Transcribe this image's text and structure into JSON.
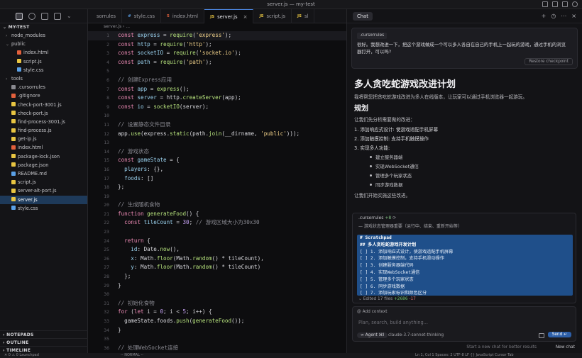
{
  "window": {
    "title": "server.js — my-test"
  },
  "explorer": {
    "root": "MY-TEST",
    "items": [
      {
        "label": "node_modules",
        "kind": "folder",
        "depth": 1,
        "chevron": "›"
      },
      {
        "label": "public",
        "kind": "folder",
        "depth": 1,
        "chevron": "⌄"
      },
      {
        "label": "index.html",
        "kind": "html",
        "depth": 2
      },
      {
        "label": "script.js",
        "kind": "js",
        "depth": 2
      },
      {
        "label": "style.css",
        "kind": "css",
        "depth": 2
      },
      {
        "label": "tools",
        "kind": "folder",
        "depth": 1,
        "chevron": "›"
      },
      {
        "label": ".cursorrules",
        "kind": "rules",
        "depth": 1
      },
      {
        "label": ".gitignore",
        "kind": "git",
        "depth": 1
      },
      {
        "label": "check-port-3001.js",
        "kind": "js",
        "depth": 1
      },
      {
        "label": "check-port.js",
        "kind": "js",
        "depth": 1
      },
      {
        "label": "find-process-3001.js",
        "kind": "js",
        "depth": 1
      },
      {
        "label": "find-process.js",
        "kind": "js",
        "depth": 1
      },
      {
        "label": "get-ip.js",
        "kind": "js",
        "depth": 1
      },
      {
        "label": "index.html",
        "kind": "html",
        "depth": 1
      },
      {
        "label": "package-lock.json",
        "kind": "json",
        "depth": 1
      },
      {
        "label": "package.json",
        "kind": "json",
        "depth": 1
      },
      {
        "label": "README.md",
        "kind": "md",
        "depth": 1
      },
      {
        "label": "script.js",
        "kind": "js",
        "depth": 1
      },
      {
        "label": "server-alt-port.js",
        "kind": "js",
        "depth": 1
      },
      {
        "label": "server.js",
        "kind": "js",
        "depth": 1,
        "selected": true
      },
      {
        "label": "style.css",
        "kind": "css",
        "depth": 1
      }
    ],
    "bottom_sections": [
      "NOTEPADS",
      "OUTLINE",
      "TIMELINE"
    ]
  },
  "colors": {
    "js": "#e8c542",
    "html": "#e2603c",
    "css": "#5aa0e6",
    "json": "#e8c542",
    "md": "#5aa0e6",
    "folder": "#8a8a90",
    "rules": "#8a8a90",
    "git": "#e2603c",
    "accent": "#4d8ae8"
  },
  "editor": {
    "tabs": [
      {
        "label": "sorrules",
        "glyph": "",
        "active": false
      },
      {
        "label": "style.css",
        "glyph": "#",
        "active": false
      },
      {
        "label": "index.html",
        "glyph": "5",
        "active": false
      },
      {
        "label": "server.js",
        "glyph": "JS",
        "active": true
      },
      {
        "label": "script.js",
        "glyph": "JS",
        "active": false
      },
      {
        "label": "sl",
        "glyph": "JS",
        "active": false
      }
    ],
    "breadcrumb": "server.js › ...",
    "lines": [
      {
        "n": "1",
        "html": "<span class='kw'>const</span> <span class='var'>express</span> = <span class='fn'>require</span>(<span class='str'>'express'</span>);",
        "cursor": true
      },
      {
        "n": "2",
        "html": "<span class='kw'>const</span> <span class='var'>http</span> = <span class='fn'>require</span>(<span class='str'>'http'</span>);"
      },
      {
        "n": "3",
        "html": "<span class='kw'>const</span> <span class='var'>socketIO</span> = <span class='fn'>require</span>(<span class='str'>'socket.io'</span>);"
      },
      {
        "n": "4",
        "html": "<span class='kw'>const</span> <span class='var'>path</span> = <span class='fn'>require</span>(<span class='str'>'path'</span>);"
      },
      {
        "n": "5",
        "html": ""
      },
      {
        "n": "6",
        "html": "<span class='cm'>// 创建Express应用</span>"
      },
      {
        "n": "7",
        "html": "<span class='kw'>const</span> <span class='var'>app</span> = <span class='fn'>express</span>();"
      },
      {
        "n": "8",
        "html": "<span class='kw'>const</span> <span class='var'>server</span> = http.<span class='fn'>createServer</span>(app);"
      },
      {
        "n": "9",
        "html": "<span class='kw'>const</span> <span class='var'>io</span> = <span class='fn'>socketIO</span>(server);"
      },
      {
        "n": "10",
        "html": ""
      },
      {
        "n": "11",
        "html": "<span class='cm'>// 设置静态文件目录</span>"
      },
      {
        "n": "12",
        "html": "app.<span class='fn'>use</span>(express.<span class='fn'>static</span>(path.<span class='fn'>join</span>(__dirname, <span class='str'>'public'</span>)));"
      },
      {
        "n": "13",
        "html": ""
      },
      {
        "n": "14",
        "html": "<span class='cm'>// 游戏状态</span>"
      },
      {
        "n": "15",
        "html": "<span class='kw'>const</span> <span class='var'>gameState</span> = {"
      },
      {
        "n": "16",
        "html": "  <span class='prop'>players</span>: {},"
      },
      {
        "n": "17",
        "html": "  <span class='prop'>foods</span>: []"
      },
      {
        "n": "18",
        "html": "};"
      },
      {
        "n": "19",
        "html": ""
      },
      {
        "n": "20",
        "html": "<span class='cm'>// 生成随机食物</span>"
      },
      {
        "n": "21",
        "html": "<span class='kw'>function</span> <span class='fn'>generateFood</span>() {"
      },
      {
        "n": "22",
        "html": "  <span class='kw'>const</span> <span class='var'>tileCount</span> = <span class='num'>30</span>; <span class='cm'>// 游戏区域大小为30x30</span>"
      },
      {
        "n": "23",
        "html": ""
      },
      {
        "n": "24",
        "html": "  <span class='kw'>return</span> {"
      },
      {
        "n": "25",
        "html": "    <span class='prop'>id</span>: Date.<span class='fn'>now</span>(),"
      },
      {
        "n": "26",
        "html": "    <span class='prop'>x</span>: Math.<span class='fn'>floor</span>(Math.<span class='fn'>random</span>() * tileCount),"
      },
      {
        "n": "27",
        "html": "    <span class='prop'>y</span>: Math.<span class='fn'>floor</span>(Math.<span class='fn'>random</span>() * tileCount)"
      },
      {
        "n": "28",
        "html": "  };"
      },
      {
        "n": "29",
        "html": "}"
      },
      {
        "n": "30",
        "html": ""
      },
      {
        "n": "31",
        "html": "<span class='cm'>// 初始化食物</span>"
      },
      {
        "n": "32",
        "html": "<span class='kw'>for</span> (<span class='kw'>let</span> i = <span class='num'>0</span>; i &lt; <span class='num'>5</span>; i++) {"
      },
      {
        "n": "33",
        "html": "  gameState.foods.<span class='fn'>push</span>(<span class='fn'>generateFood</span>());"
      },
      {
        "n": "34",
        "html": "}"
      },
      {
        "n": "35",
        "html": ""
      },
      {
        "n": "36",
        "html": "<span class='cm'>// 处理WebSocket连接</span>"
      }
    ]
  },
  "chat": {
    "tab_label": "Chat",
    "header_icons": [
      "+",
      "◷",
      "⋯",
      "×"
    ],
    "user_message": {
      "chip": ".cursorrules",
      "text": "很好。我想改进一下，把这个游戏做成一个可以多人各自在自己的手机上一起玩的游戏，通过手机的浏览器打开，可以吗?",
      "restore_label": "Restore checkpoint"
    },
    "answer": {
      "title": "多人贪吃蛇游戏改进计划",
      "intro": "我将帮您把贪吃蛇游戏改进为多人在线版本，让玩家可以通过手机浏览器一起游玩。",
      "section": "规划",
      "lead": "让我们先分析需要做的改进：",
      "steps": [
        "1. 添加响应式设计: 使游戏适配手机屏幕",
        "2. 添加触摸控制: 支持手机触摸操作",
        "3. 实现多人功能:"
      ],
      "bullets": [
        "建立服务器端",
        "实现WebSocket通信",
        "管理多个玩家状态",
        "同步游戏数据"
      ],
      "closing": "让我们开始实施这些改进。"
    },
    "composer": {
      "file_chip": ".cursorrules",
      "file_count": "+8",
      "sub_text": "— 游戏状态管理器重要（运行中、结束、重新开始等）",
      "lines": [
        "# Scratchpad",
        "## 多人贪吃蛇游戏开发计划",
        "[ ] 1. 添加响应式设计，使游戏适配手机屏幕",
        "[ ] 2. 添加触摸控制，支持手机滑动操作",
        "[ ] 3. 创建服务器端代码",
        "[ ] 4. 实现WebSocket通信",
        "[ ] 5. 管理多个玩家状态",
        "[ ] 6. 同步游戏数据",
        "[ ] 7. 添加玩家标识和颜色区分"
      ],
      "edited_label": "Edited 17 files",
      "added": "+2686",
      "removed": "-17"
    },
    "input": {
      "add_context": "@ Add context",
      "placeholder": "Plan, search, build anything...",
      "agent_label": "∞ Agent ⌘I",
      "model_label": "claude-3.7-sonnet-thinking",
      "send_label": "Send ↵"
    },
    "footer": {
      "hint": "Start a new chat for better results",
      "new_chat": "New chat"
    }
  },
  "statusbar": {
    "left": "✕ 0 ⚠ 0   Launchpad",
    "mid": "-- NORMAL --",
    "right": "Ln 1, Col 1   Spaces: 2   UTF-8   LF   {} JavaScript   Cursor Tab"
  }
}
